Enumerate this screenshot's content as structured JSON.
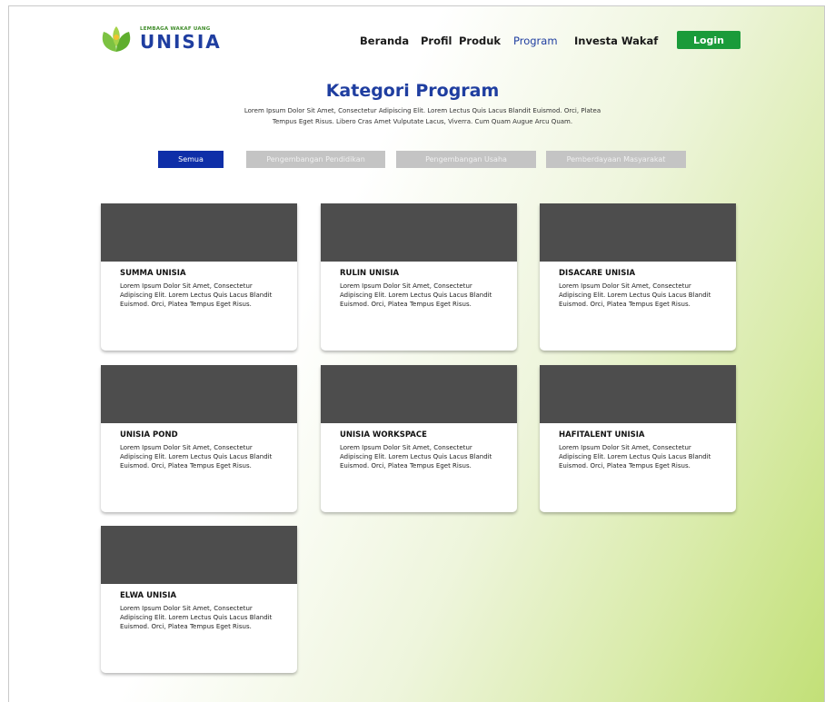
{
  "header": {
    "logo_small": "LEMBAGA WAKAF UANG",
    "logo_big": "UNISIA",
    "nav": [
      "Beranda",
      "Profil",
      "Produk",
      "Program",
      "Investa Wakaf"
    ],
    "active_nav": "Program",
    "login_label": "Login"
  },
  "main": {
    "title": "Kategori Program",
    "description_line1": "Lorem Ipsum Dolor Sit Amet, Consectetur Adipiscing Elit. Lorem Lectus Quis Lacus Blandit Euismod. Orci, Platea",
    "description_line2": "Tempus Eget Risus. Libero Cras Amet Vulputate Lacus, Viverra. Cum Quam Augue Arcu Quam.",
    "filters": [
      "Semua",
      "Pengembangan Pendidikan",
      "Pengembangan Usaha",
      "Pemberdayaan Masyarakat"
    ],
    "active_filter": "Semua"
  },
  "cards": [
    {
      "title": "SUMMA UNISIA",
      "description": "Lorem Ipsum Dolor Sit Amet, Consectetur Adipiscing Elit. Lorem Lectus Quis Lacus Blandit Euismod. Orci, Platea Tempus Eget Risus."
    },
    {
      "title": "RULIN UNISIA",
      "description": "Lorem Ipsum Dolor Sit Amet, Consectetur Adipiscing Elit. Lorem Lectus Quis Lacus Blandit Euismod. Orci, Platea Tempus Eget Risus."
    },
    {
      "title": "DISACARE UNISIA",
      "description": "Lorem Ipsum Dolor Sit Amet, Consectetur Adipiscing Elit. Lorem Lectus Quis Lacus Blandit Euismod. Orci, Platea Tempus Eget Risus."
    },
    {
      "title": "UNISIA POND",
      "description": "Lorem Ipsum Dolor Sit Amet, Consectetur Adipiscing Elit. Lorem Lectus Quis Lacus Blandit Euismod. Orci, Platea Tempus Eget Risus."
    },
    {
      "title": "UNISIA WORKSPACE",
      "description": "Lorem Ipsum Dolor Sit Amet, Consectetur Adipiscing Elit. Lorem Lectus Quis Lacus Blandit Euismod. Orci, Platea Tempus Eget Risus."
    },
    {
      "title": "HAFITALENT UNISIA",
      "description": "Lorem Ipsum Dolor Sit Amet, Consectetur Adipiscing Elit. Lorem Lectus Quis Lacus Blandit Euismod. Orci, Platea Tempus Eget Risus."
    },
    {
      "title": "ELWA UNISIA",
      "description": "Lorem Ipsum Dolor Sit Amet, Consectetur Adipiscing Elit. Lorem Lectus Quis Lacus Blandit Euismod. Orci, Platea Tempus Eget Risus."
    }
  ],
  "colors": {
    "brand_blue": "#1f3ea0",
    "login_green": "#1a9b3a",
    "filter_active": "#0f2fa8",
    "filter_inactive": "#c4c4c4",
    "card_image": "#4d4d4d"
  },
  "icons": {
    "logo": "leaf-logo-icon"
  }
}
